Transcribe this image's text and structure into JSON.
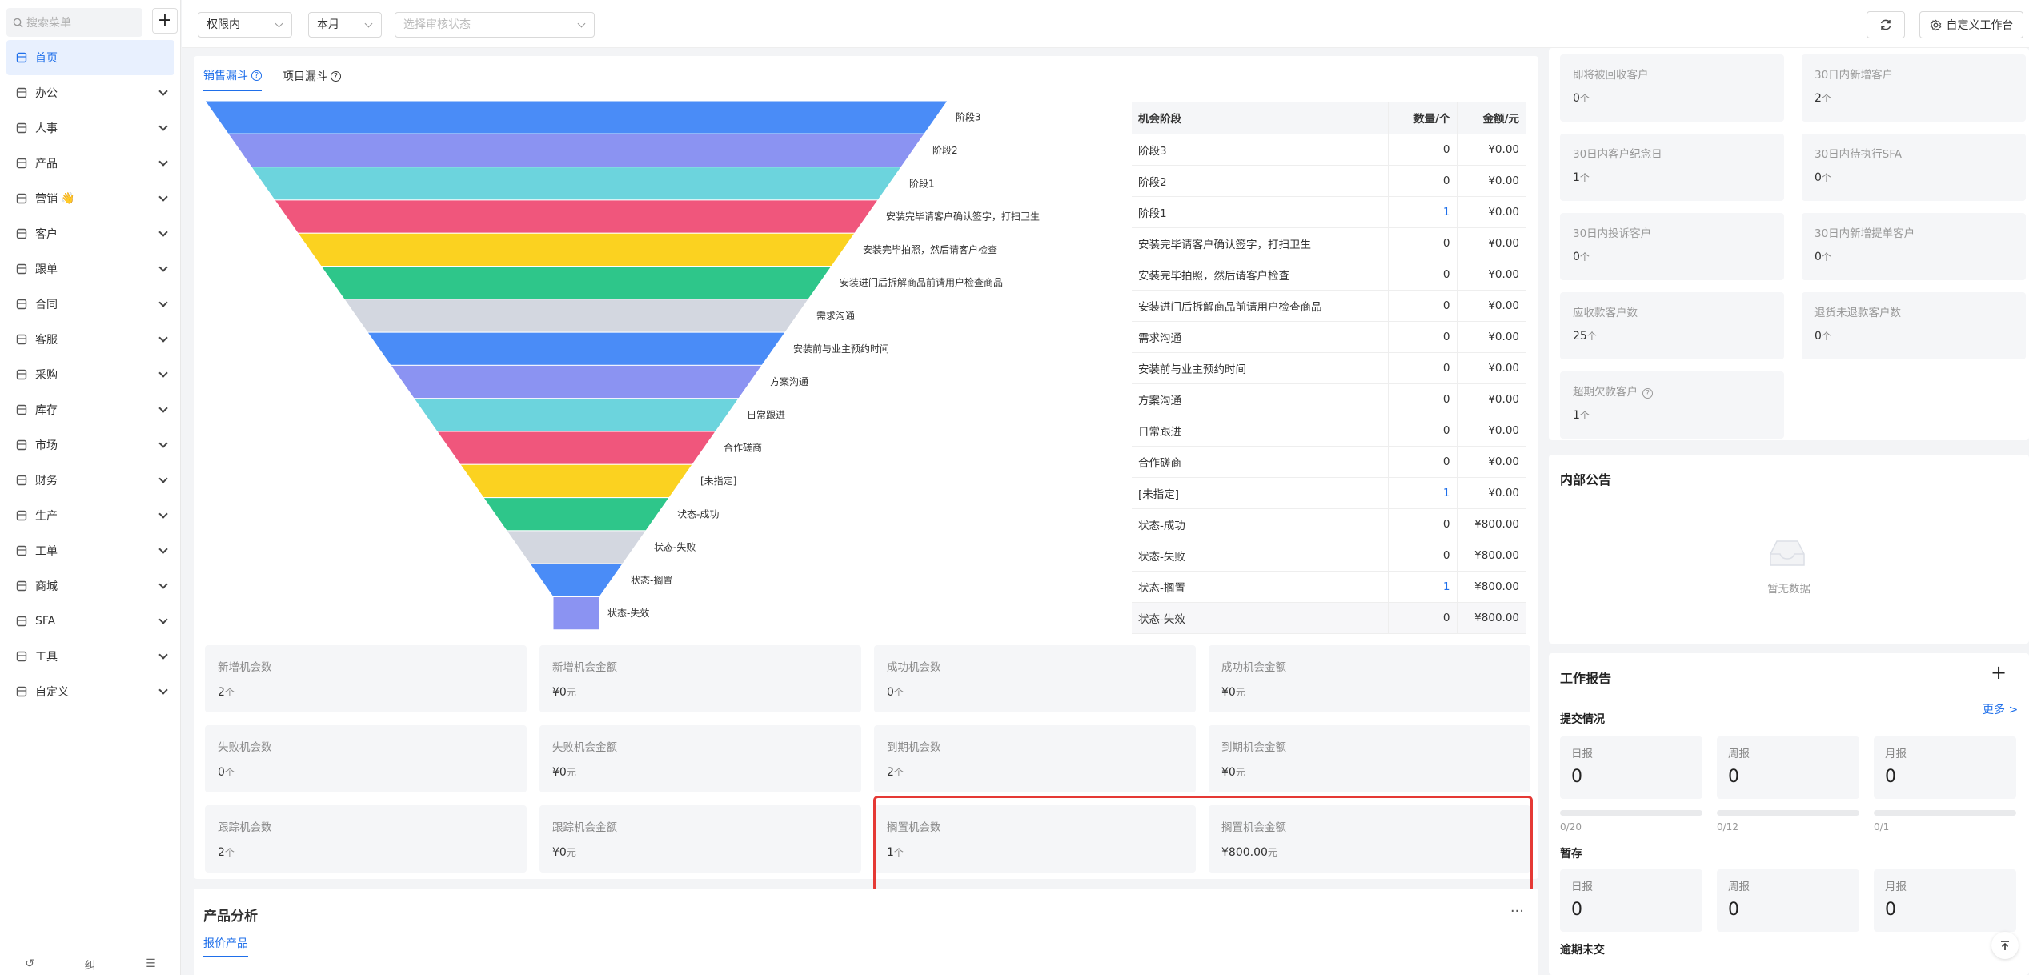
{
  "sidebar": {
    "search_placeholder": "搜索菜单",
    "add_label": "+",
    "items": [
      {
        "label": "首页",
        "icon": "grid-icon",
        "active": true
      },
      {
        "label": "办公",
        "icon": "inbox-icon"
      },
      {
        "label": "人事",
        "icon": "people-icon"
      },
      {
        "label": "产品",
        "icon": "cube-icon"
      },
      {
        "label": "营销",
        "icon": "copy-icon",
        "emoji": "👋"
      },
      {
        "label": "客户",
        "icon": "customer-icon"
      },
      {
        "label": "跟单",
        "icon": "layers-icon"
      },
      {
        "label": "合同",
        "icon": "document-icon"
      },
      {
        "label": "客服",
        "icon": "headset-icon"
      },
      {
        "label": "采购",
        "icon": "basket-icon"
      },
      {
        "label": "库存",
        "icon": "warehouse-icon"
      },
      {
        "label": "市场",
        "icon": "book-icon"
      },
      {
        "label": "财务",
        "icon": "home-icon"
      },
      {
        "label": "生产",
        "icon": "tools-icon"
      },
      {
        "label": "工单",
        "icon": "ticket-icon"
      },
      {
        "label": "商城",
        "icon": "store-icon"
      },
      {
        "label": "SFA",
        "icon": "refresh-icon"
      },
      {
        "label": "工具",
        "icon": "toolbox-icon"
      },
      {
        "label": "自定义",
        "icon": "apps-icon"
      }
    ]
  },
  "topbar": {
    "filter_scope": "权限内",
    "filter_period": "本月",
    "filter_status_placeholder": "选择审核状态",
    "custom_workbench": "自定义工作台"
  },
  "funnel_card": {
    "tabs": [
      "销售漏斗",
      "项目漏斗"
    ],
    "stages": [
      {
        "label": "阶段3",
        "color": "#4a8cf7"
      },
      {
        "label": "阶段2",
        "color": "#8b93f2"
      },
      {
        "label": "阶段1",
        "color": "#6cd4dd"
      },
      {
        "label": "安装完毕请客户确认签字，打扫卫生",
        "color": "#f0567c"
      },
      {
        "label": "安装完毕拍照，然后请客户检查",
        "color": "#fbd220"
      },
      {
        "label": "安装进门后拆解商品前请用户检查商品",
        "color": "#2ec68a"
      },
      {
        "label": "需求沟通",
        "color": "#d3d7e0"
      },
      {
        "label": "安装前与业主预约时间",
        "color": "#4a8cf7"
      },
      {
        "label": "方案沟通",
        "color": "#8b93f2"
      },
      {
        "label": "日常跟进",
        "color": "#6cd4dd"
      },
      {
        "label": "合作磋商",
        "color": "#f0567c"
      },
      {
        "label": "[未指定]",
        "color": "#fbd220"
      },
      {
        "label": "状态-成功",
        "color": "#2ec68a"
      },
      {
        "label": "状态-失败",
        "color": "#d3d7e0"
      },
      {
        "label": "状态-搁置",
        "color": "#4a8cf7"
      },
      {
        "label": "状态-失效",
        "color": "#8b93f2"
      }
    ],
    "table": {
      "headers": [
        "机会阶段",
        "数量/个",
        "金额/元"
      ],
      "rows": [
        {
          "stage": "阶段3",
          "count": "0",
          "amount": "¥0.00"
        },
        {
          "stage": "阶段2",
          "count": "0",
          "amount": "¥0.00"
        },
        {
          "stage": "阶段1",
          "count": "1",
          "amount": "¥0.00",
          "link": true
        },
        {
          "stage": "安装完毕请客户确认签字，打扫卫生",
          "count": "0",
          "amount": "¥0.00"
        },
        {
          "stage": "安装完毕拍照，然后请客户检查",
          "count": "0",
          "amount": "¥0.00"
        },
        {
          "stage": "安装进门后拆解商品前请用户检查商品",
          "count": "0",
          "amount": "¥0.00"
        },
        {
          "stage": "需求沟通",
          "count": "0",
          "amount": "¥0.00"
        },
        {
          "stage": "安装前与业主预约时间",
          "count": "0",
          "amount": "¥0.00"
        },
        {
          "stage": "方案沟通",
          "count": "0",
          "amount": "¥0.00"
        },
        {
          "stage": "日常跟进",
          "count": "0",
          "amount": "¥0.00"
        },
        {
          "stage": "合作磋商",
          "count": "0",
          "amount": "¥0.00"
        },
        {
          "stage": "[未指定]",
          "count": "1",
          "amount": "¥0.00",
          "link": true
        },
        {
          "stage": "状态-成功",
          "count": "0",
          "amount": "¥800.00"
        },
        {
          "stage": "状态-失败",
          "count": "0",
          "amount": "¥800.00"
        },
        {
          "stage": "状态-搁置",
          "count": "1",
          "amount": "¥800.00",
          "link": true
        },
        {
          "stage": "状态-失效",
          "count": "0",
          "amount": "¥800.00"
        }
      ]
    },
    "stats": [
      {
        "label": "新增机会数",
        "value": "2",
        "unit": "个"
      },
      {
        "label": "新增机会金额",
        "value": "¥0",
        "unit": "元"
      },
      {
        "label": "成功机会数",
        "value": "0",
        "unit": "个"
      },
      {
        "label": "成功机会金额",
        "value": "¥0",
        "unit": "元"
      },
      {
        "label": "失败机会数",
        "value": "0",
        "unit": "个"
      },
      {
        "label": "失败机会金额",
        "value": "¥0",
        "unit": "元"
      },
      {
        "label": "到期机会数",
        "value": "2",
        "unit": "个"
      },
      {
        "label": "到期机会金额",
        "value": "¥0",
        "unit": "元"
      },
      {
        "label": "跟踪机会数",
        "value": "2",
        "unit": "个"
      },
      {
        "label": "跟踪机会金额",
        "value": "¥0",
        "unit": "元"
      },
      {
        "label": "搁置机会数",
        "value": "1",
        "unit": "个"
      },
      {
        "label": "搁置机会金额",
        "value": "¥800.00",
        "unit": "元"
      }
    ]
  },
  "product_analysis": {
    "title": "产品分析",
    "more": "···",
    "tab": "报价产品"
  },
  "customer_kpis": [
    {
      "label": "即将被回收客户",
      "value": "0",
      "unit": "个"
    },
    {
      "label": "30日内新增客户",
      "value": "2",
      "unit": "个"
    },
    {
      "label": "30日内客户纪念日",
      "value": "1",
      "unit": "个"
    },
    {
      "label": "30日内待执行SFA",
      "value": "0",
      "unit": "个"
    },
    {
      "label": "30日内投诉客户",
      "value": "0",
      "unit": "个"
    },
    {
      "label": "30日内新增提单客户",
      "value": "0",
      "unit": "个"
    },
    {
      "label": "应收款客户数",
      "value": "25",
      "unit": "个"
    },
    {
      "label": "退货未退款客户数",
      "value": "0",
      "unit": "个"
    },
    {
      "label": "超期欠款客户",
      "value": "1",
      "unit": "个",
      "help": true
    }
  ],
  "notice": {
    "title": "内部公告",
    "empty": "暂无数据"
  },
  "work_report": {
    "title": "工作报告",
    "add": "+",
    "submit_title": "提交情况",
    "more": "更多 >",
    "submitted": [
      {
        "label": "日报",
        "value": "0",
        "progress": "0/20"
      },
      {
        "label": "周报",
        "value": "0",
        "progress": "0/12"
      },
      {
        "label": "月报",
        "value": "0",
        "progress": "0/1"
      }
    ],
    "draft_title": "暂存",
    "drafts": [
      {
        "label": "日报",
        "value": "0"
      },
      {
        "label": "周报",
        "value": "0"
      },
      {
        "label": "月报",
        "value": "0"
      }
    ],
    "overdue_title": "逾期未交"
  },
  "side_bottom": [
    "↺",
    "纠",
    "☰"
  ]
}
